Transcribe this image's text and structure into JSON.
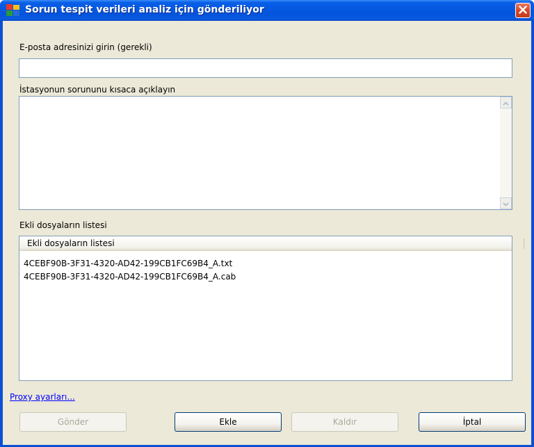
{
  "window": {
    "title": "Sorun tespit verileri analiz için gönderiliyor"
  },
  "email": {
    "label": "E-posta adresinizi girin (gerekli)",
    "value": ""
  },
  "description": {
    "label": "İstasyonun sorununu kısaca açıklayın",
    "value": ""
  },
  "attachments": {
    "label": "Ekli dosyaların listesi",
    "column_header": "Ekli dosyaların listesi",
    "files": [
      "4CEBF90B-3F31-4320-AD42-199CB1FC69B4_A.txt",
      "4CEBF90B-3F31-4320-AD42-199CB1FC69B4_A.cab"
    ]
  },
  "proxy_link": "Proxy ayarları...",
  "buttons": {
    "send": {
      "label": "Gönder",
      "enabled": false
    },
    "add": {
      "label": "Ekle",
      "enabled": true
    },
    "remove": {
      "label": "Kaldır",
      "enabled": false
    },
    "cancel": {
      "label": "İptal",
      "enabled": true
    }
  },
  "colors": {
    "titlebar": "#0558e0",
    "dialog_bg": "#ece9d8",
    "close_button": "#d8482a",
    "link": "#0000ff"
  },
  "icons": {
    "app": "avg-logo-icon",
    "close": "close-icon",
    "scroll_up": "chevron-up-icon",
    "scroll_down": "chevron-down-icon"
  }
}
